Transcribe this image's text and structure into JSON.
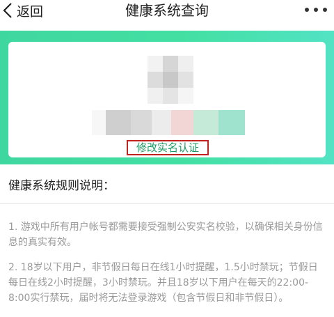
{
  "header": {
    "back_label": "返回",
    "title": "健康系统查询",
    "more_icon": "more-dots-icon"
  },
  "card": {
    "edit_link": "修改实名认证"
  },
  "rules": {
    "heading": "健康系统规则说明：",
    "items": [
      "1. 游戏中所有用户帐号都需要接受强制公安实名校验，以确保相关身份信息的真实有效。",
      "2. 18岁以下用户，非节假日每日在线1小时提醒，1.5小时禁玩；节假日每日在线2小时提醒，3小时禁玩。并且18岁以下用户在每天的22:00-8:00实行禁玩，届时将无法登录游戏（包含节假日和非节假日）。"
    ]
  },
  "colors": {
    "accent_green": "#3fd7a0",
    "link_green": "#1a9a62",
    "highlight_red": "#c0221e"
  }
}
